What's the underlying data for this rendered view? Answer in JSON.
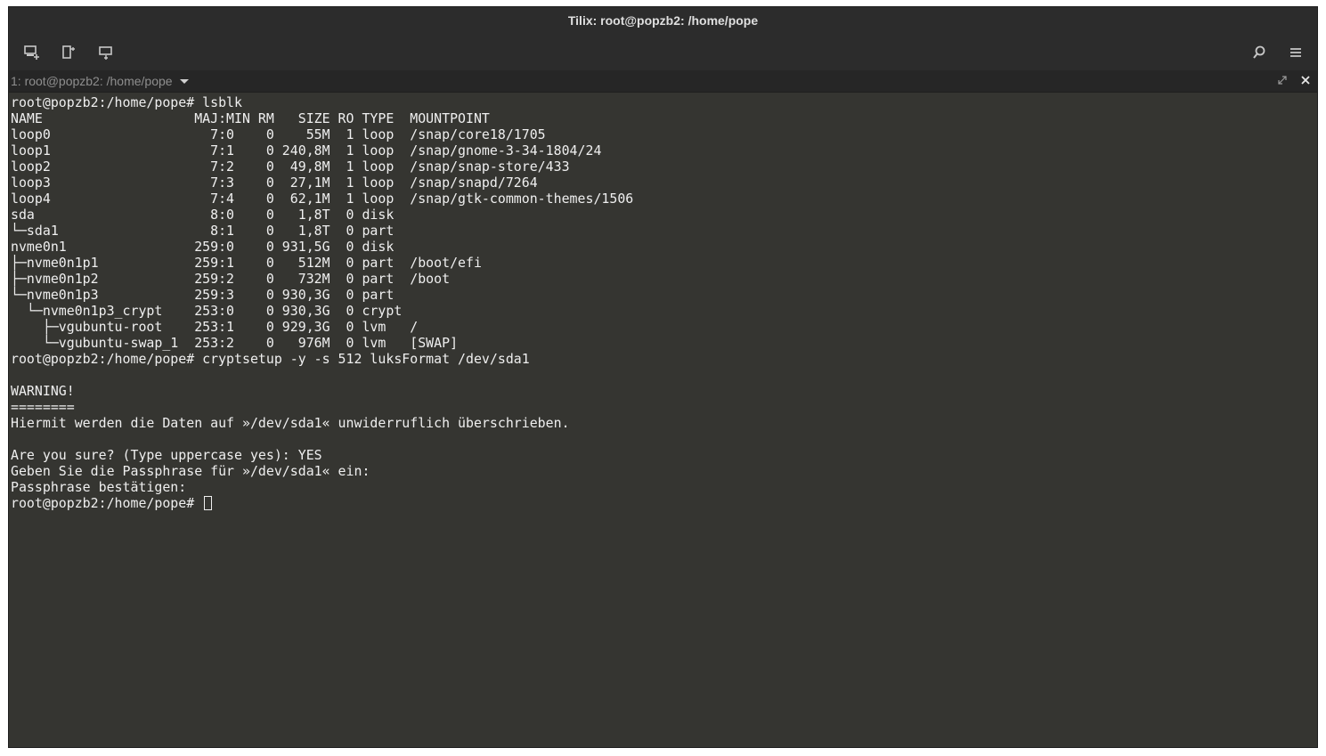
{
  "window": {
    "title": "Tilix: root@popzb2: /home/pope"
  },
  "toolbar": {
    "icons": [
      "add-terminal-icon",
      "split-right-icon",
      "split-down-icon",
      "search-icon",
      "hamburger-menu-icon"
    ]
  },
  "session": {
    "title": "1: root@popzb2: /home/pope",
    "icons": [
      "maximize-icon",
      "close-icon"
    ]
  },
  "terminal": {
    "lines": [
      "root@popzb2:/home/pope# lsblk",
      "NAME                   MAJ:MIN RM   SIZE RO TYPE  MOUNTPOINT",
      "loop0                    7:0    0    55M  1 loop  /snap/core18/1705",
      "loop1                    7:1    0 240,8M  1 loop  /snap/gnome-3-34-1804/24",
      "loop2                    7:2    0  49,8M  1 loop  /snap/snap-store/433",
      "loop3                    7:3    0  27,1M  1 loop  /snap/snapd/7264",
      "loop4                    7:4    0  62,1M  1 loop  /snap/gtk-common-themes/1506",
      "sda                      8:0    0   1,8T  0 disk  ",
      "└─sda1                   8:1    0   1,8T  0 part  ",
      "nvme0n1                259:0    0 931,5G  0 disk  ",
      "├─nvme0n1p1            259:1    0   512M  0 part  /boot/efi",
      "├─nvme0n1p2            259:2    0   732M  0 part  /boot",
      "└─nvme0n1p3            259:3    0 930,3G  0 part  ",
      "  └─nvme0n1p3_crypt    253:0    0 930,3G  0 crypt ",
      "    ├─vgubuntu-root    253:1    0 929,3G  0 lvm   /",
      "    └─vgubuntu-swap_1  253:2    0   976M  0 lvm   [SWAP]",
      "root@popzb2:/home/pope# cryptsetup -y -s 512 luksFormat /dev/sda1",
      "",
      "WARNING!",
      "========",
      "Hiermit werden die Daten auf »/dev/sda1« unwiderruflich überschrieben.",
      "",
      "Are you sure? (Type uppercase yes): YES",
      "Geben Sie die Passphrase für »/dev/sda1« ein: ",
      "Passphrase bestätigen: "
    ],
    "prompt": "root@popzb2:/home/pope# "
  },
  "colors": {
    "terminal_bg": "#353531",
    "terminal_fg": "#efefef",
    "header_bg": "#2c2c2c"
  }
}
